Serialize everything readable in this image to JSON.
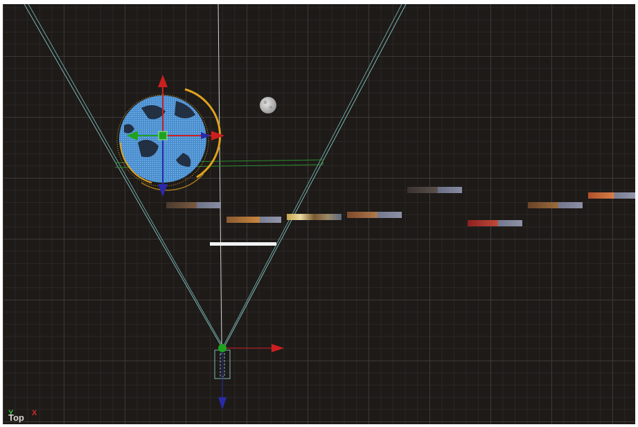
{
  "viewport": {
    "view_label": "Top",
    "axis_y_label": "Y",
    "axis_x_label": "X"
  },
  "colors": {
    "background": "#1d1a18",
    "grid_major": "#3b3836",
    "grid_minor": "#2a2725",
    "frustum": "#7fb8b6",
    "axis_x": "#cc1f1f",
    "axis_y": "#1fa31f",
    "axis_z": "#2a2aa8",
    "selection_ring": "#e0a21c",
    "globe": "#4a8fd0"
  },
  "icons": {
    "camera": "camera-icon",
    "globe": "globe-icon",
    "moon": "moon-icon",
    "gizmo": "move-gizmo-icon"
  }
}
